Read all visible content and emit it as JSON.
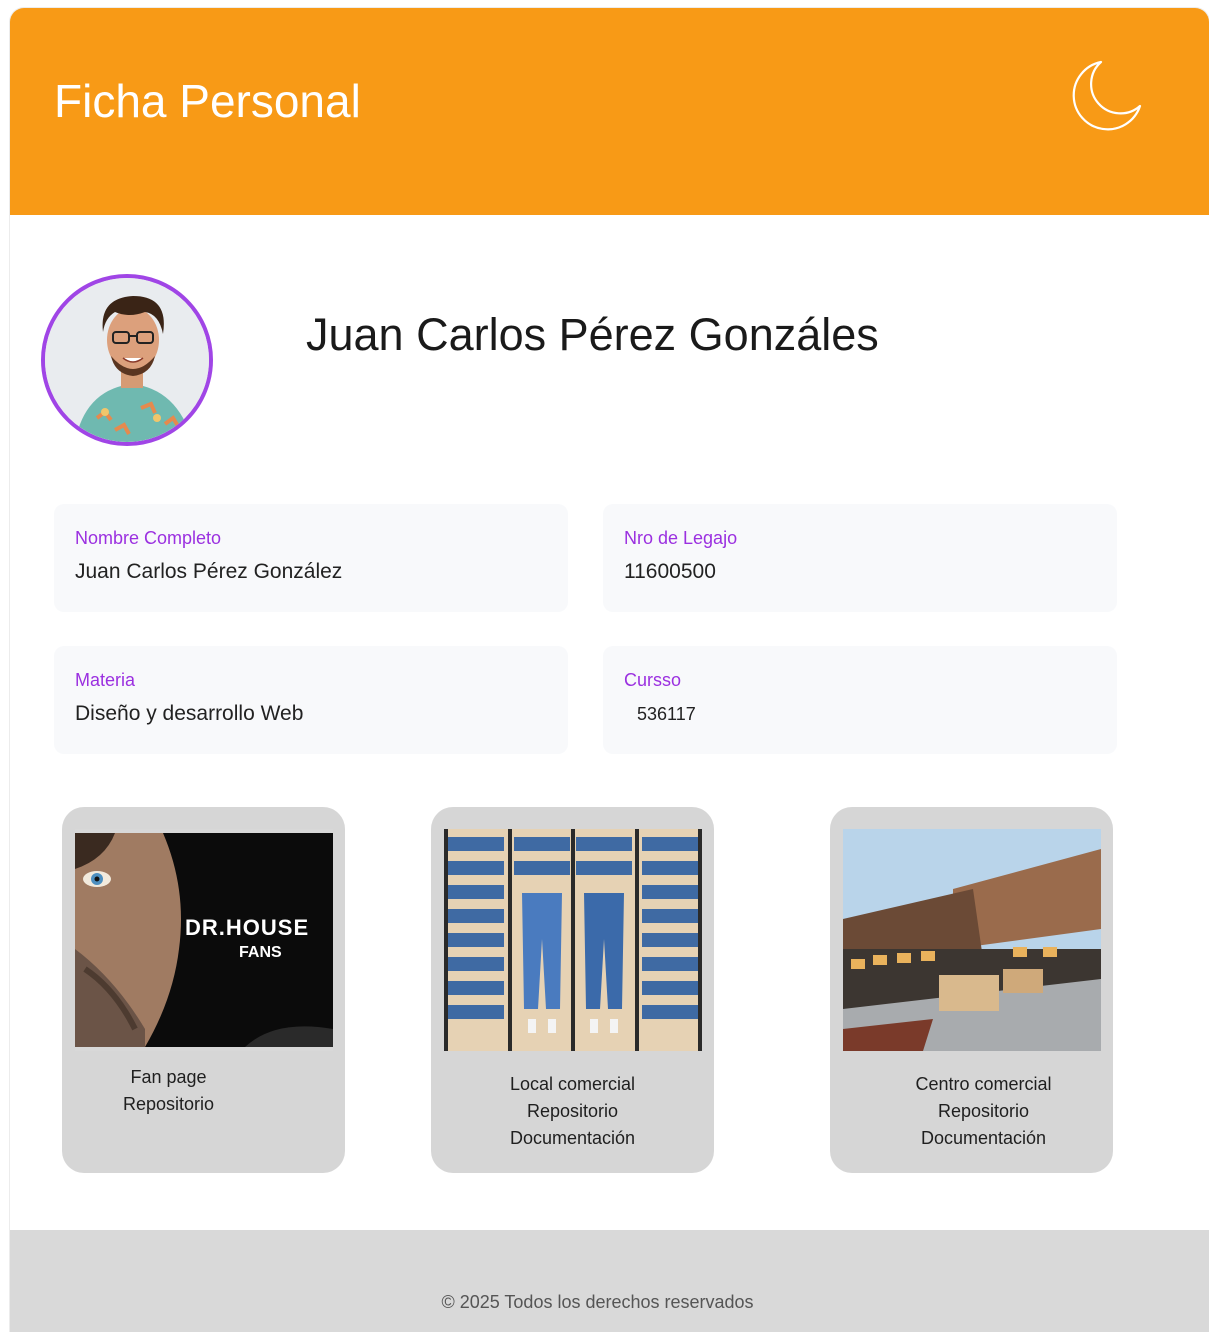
{
  "header": {
    "title": "Ficha Personal",
    "theme_icon": "moon-icon",
    "background_color": "#f89a16"
  },
  "profile": {
    "name": "Juan Carlos Pérez Gonzáles",
    "avatar_border_color": "#a045e6"
  },
  "info": {
    "nombre": {
      "label": "Nombre Completo",
      "value": "Juan Carlos Pérez González"
    },
    "legajo": {
      "label": "Nro de Legajo",
      "value": "11600500"
    },
    "materia": {
      "label": "Materia",
      "value": "Diseño y desarrollo Web"
    },
    "curso": {
      "label": "Cursso",
      "value": "536117"
    },
    "label_color": "#9b30e0"
  },
  "projects": [
    {
      "image_text_1": "DR.HOUSE",
      "image_text_2": "FANS",
      "links": [
        "Fan page",
        "Repositorio"
      ]
    },
    {
      "links": [
        "Local comercial",
        "Repositorio",
        "Documentación"
      ]
    },
    {
      "links": [
        "Centro comercial",
        "Repositorio",
        "Documentación"
      ]
    }
  ],
  "footer": {
    "text": "© 2025 Todos los derechos reservados"
  }
}
